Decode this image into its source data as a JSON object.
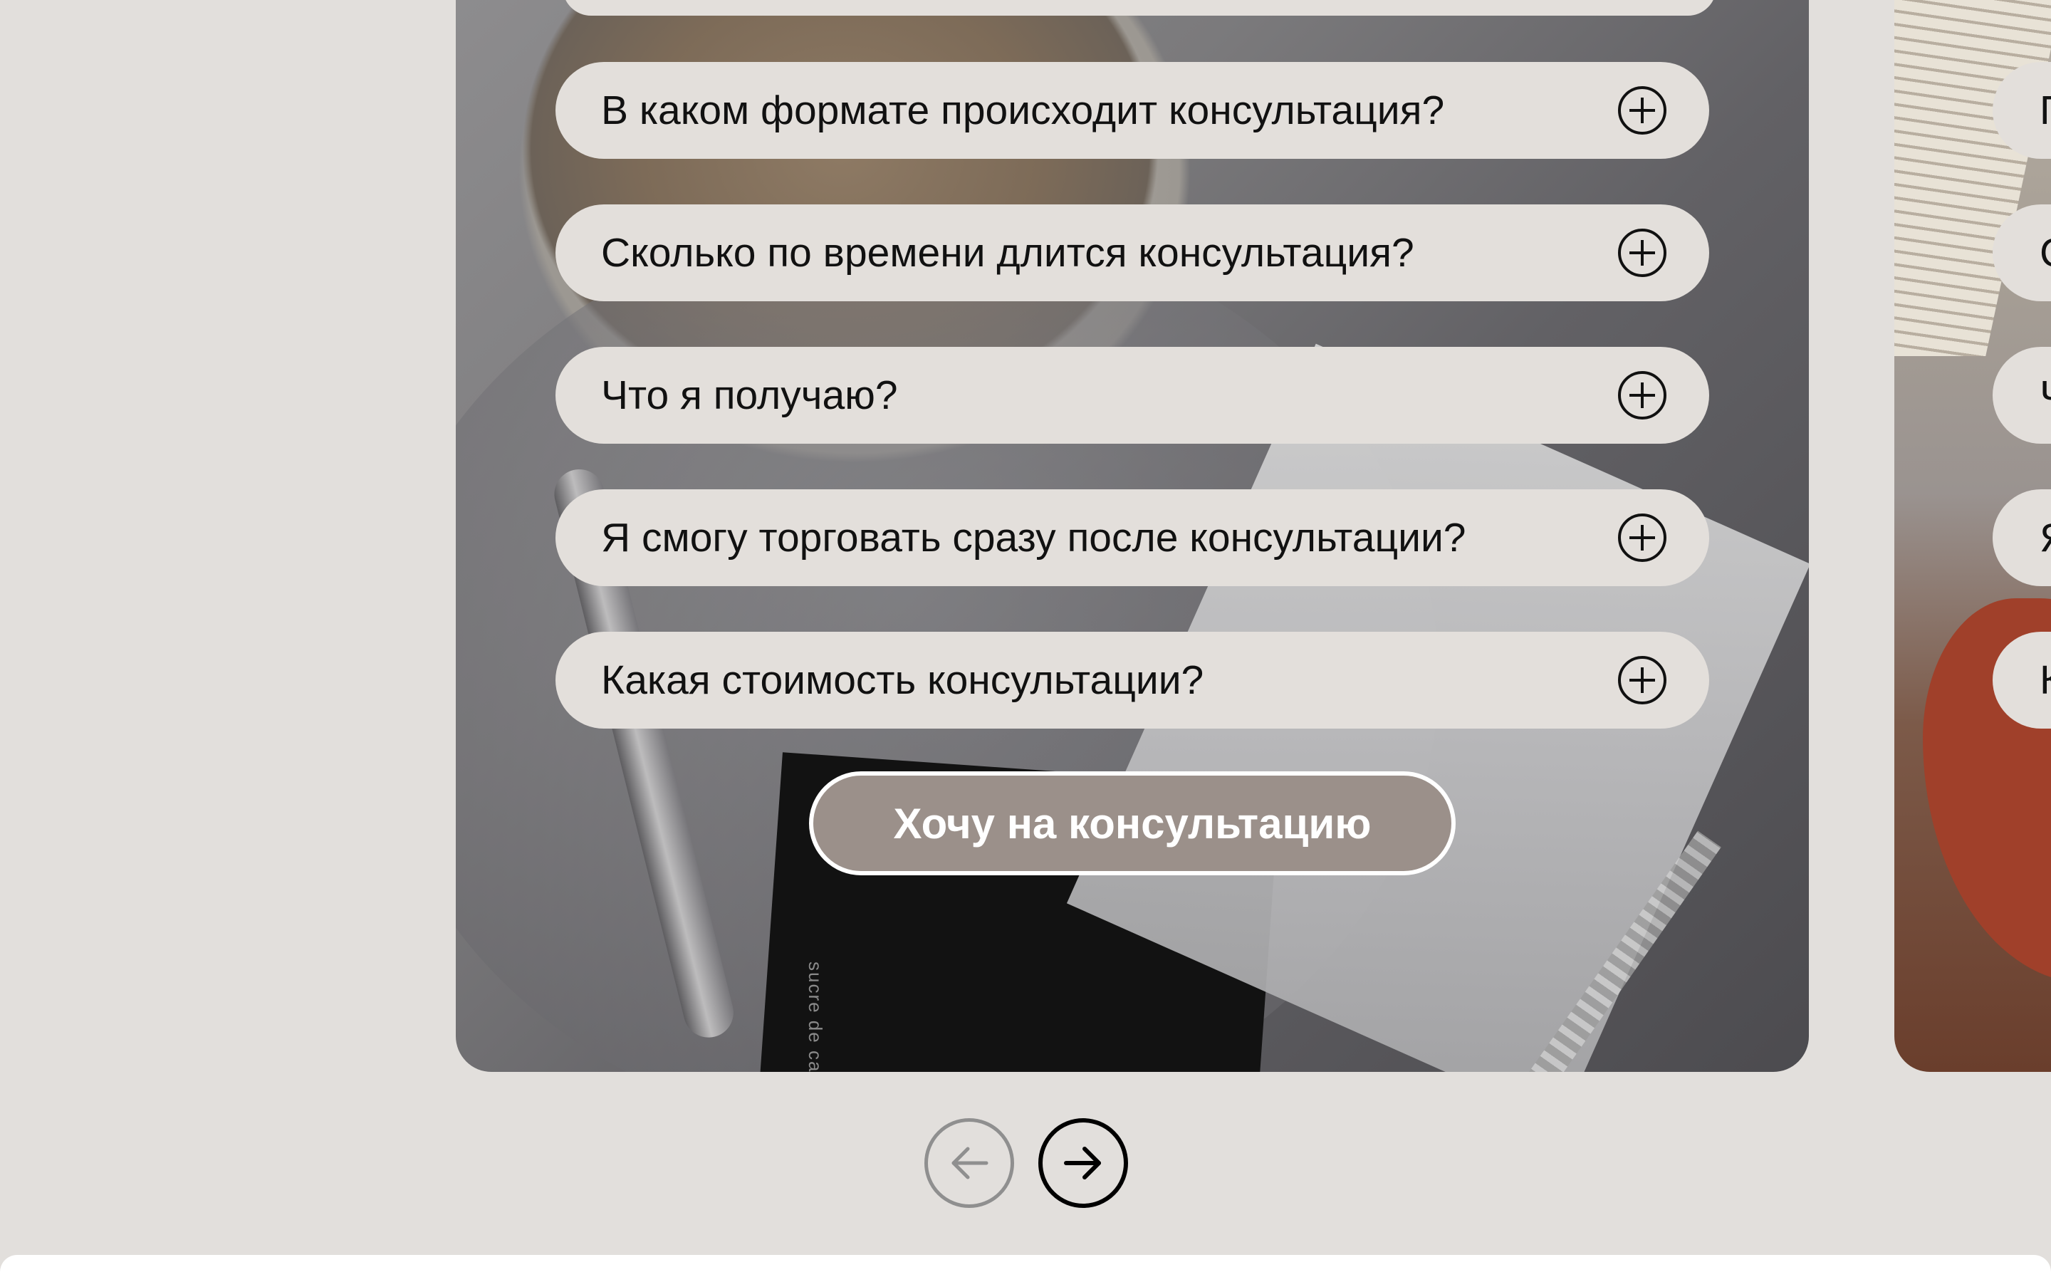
{
  "faq": {
    "items": [
      {
        "question": "В каком формате происходит консультация?"
      },
      {
        "question": "Сколько по времени длится консультация?"
      },
      {
        "question": "Что я получаю?"
      },
      {
        "question": "Я смогу торговать сразу после консультации?"
      },
      {
        "question": "Какая стоимость консультации?"
      }
    ],
    "expand_icon": "plus-circle-icon"
  },
  "cta": {
    "label": "Хочу на консультацию"
  },
  "background_photo": {
    "packet_text": "sucre de ca"
  },
  "next_card": {
    "partial_letters": [
      "П",
      "С",
      "Ч",
      "Я",
      "К"
    ]
  },
  "carousel": {
    "prev_icon": "arrow-left-icon",
    "next_icon": "arrow-right-icon",
    "prev_state": "disabled",
    "next_state": "enabled"
  },
  "colors": {
    "page_bg": "#e2dfdc",
    "pill_bg": "#e3dfdb",
    "cta_bg": "#9b908a",
    "cta_border": "#ffffff",
    "nav_disabled": "#8f8f8f",
    "nav_enabled": "#000000"
  }
}
